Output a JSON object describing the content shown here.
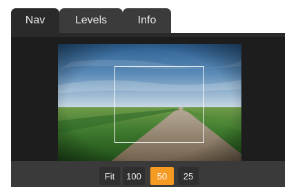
{
  "tabs": [
    {
      "label": "Nav",
      "active": true
    },
    {
      "label": "Levels",
      "active": false
    },
    {
      "label": "Info",
      "active": false
    }
  ],
  "zoom": {
    "options": [
      "Fit",
      "100",
      "50",
      "25"
    ],
    "selected": "50"
  },
  "colors": {
    "accent": "#f59a23",
    "panel": "#2a2a2a",
    "tab_inactive": "#3b3b3b",
    "zoom_bar": "#3a3a3a"
  }
}
